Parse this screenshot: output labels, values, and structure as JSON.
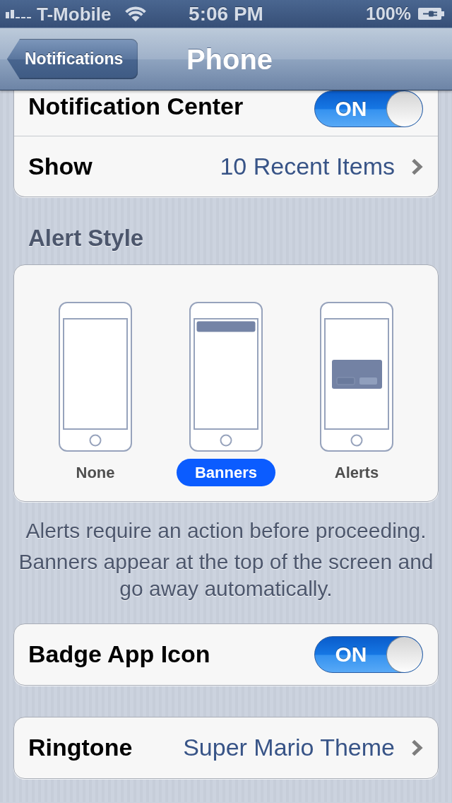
{
  "status_bar": {
    "carrier": "T-Mobile",
    "time": "5:06 PM",
    "battery": "100%"
  },
  "nav_bar": {
    "back_button": "Notifications",
    "title": "Phone"
  },
  "sections": [
    {
      "kind": "group",
      "rows": [
        {
          "kind": "switch",
          "label": "Notification Center",
          "on": true,
          "text": "ON"
        },
        {
          "kind": "disclosure",
          "label": "Show",
          "value": "10 Recent Items"
        }
      ]
    },
    {
      "kind": "alert_style",
      "header": "Alert Style",
      "options": [
        {
          "kind": "none",
          "label": "None",
          "selected": false
        },
        {
          "kind": "banner",
          "label": "Banners",
          "selected": true
        },
        {
          "kind": "alert",
          "label": "Alerts",
          "selected": false
        }
      ],
      "footer": [
        "Alerts require an action before proceeding.",
        "Banners appear at the top of the screen and go away automatically."
      ]
    },
    {
      "kind": "group",
      "rows": [
        {
          "kind": "switch",
          "label": "Badge App Icon",
          "on": true,
          "text": "ON"
        }
      ]
    },
    {
      "kind": "group",
      "rows": [
        {
          "kind": "disclosure",
          "label": "Ringtone",
          "value": "Super Mario Theme"
        }
      ]
    }
  ]
}
